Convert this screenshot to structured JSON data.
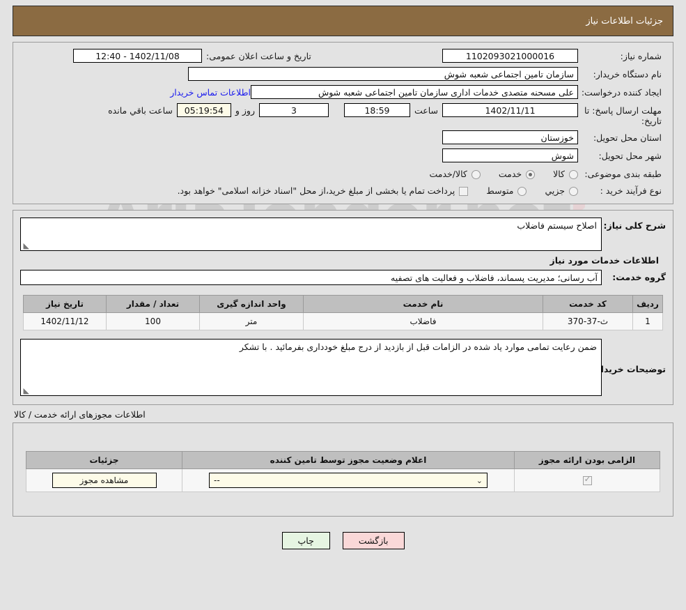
{
  "header": {
    "title": "جزئیات اطلاعات نیاز"
  },
  "watermark": {
    "text": "AriaTender.net"
  },
  "info": {
    "need_number_label": "شماره نیاز:",
    "need_number_value": "1102093021000016",
    "announce_label": "تاریخ و ساعت اعلان عمومی:",
    "announce_value": "1402/11/08 - 12:40",
    "buyer_org_label": "نام دستگاه خریدار:",
    "buyer_org_value": "سازمان تامین اجتماعی شعبه شوش",
    "creator_label": "ایجاد کننده درخواست:",
    "creator_value": "علی مسحنه متصدی خدمات اداری سازمان تامین اجتماعی شعبه شوش",
    "contact_link": "اطلاعات تماس خریدار",
    "deadline_label": "مهلت ارسال پاسخ: تا تاریخ:",
    "deadline_date": "1402/11/11",
    "time_label": "ساعت",
    "deadline_time": "18:59",
    "days_value": "3",
    "days_label": "روز و",
    "countdown_value": "05:19:54",
    "countdown_label": "ساعت باقي مانده",
    "province_label": "استان محل تحویل:",
    "province_value": "خوزستان",
    "city_label": "شهر محل تحویل:",
    "city_value": "شوش",
    "category_label": "طبقه بندی موضوعی:",
    "category_options": [
      {
        "label": "کالا",
        "selected": false
      },
      {
        "label": "خدمت",
        "selected": true
      },
      {
        "label": "کالا/خدمت",
        "selected": false
      }
    ],
    "process_label": "نوع فرآیند خرید :",
    "process_options": [
      {
        "label": "جزیي",
        "selected": false
      },
      {
        "label": "متوسط",
        "selected": false
      }
    ],
    "treasury_checked": false,
    "treasury_note": "پرداخت تمام یا بخشی از مبلغ خرید،از محل \"اسناد خزانه اسلامی\" خواهد بود."
  },
  "description": {
    "need_desc_label": "شرح کلی نیاز:",
    "need_desc_value": "اصلاح سیستم فاضلاب",
    "services_heading": "اطلاعات خدمات مورد نیاز",
    "service_group_label": "گروه خدمت:",
    "service_group_value": "آب رسانی؛ مدیریت پسماند، فاضلاب و فعالیت های تصفیه"
  },
  "items_table": {
    "columns": [
      "ردیف",
      "کد خدمت",
      "نام خدمت",
      "واحد اندازه گیری",
      "تعداد / مقدار",
      "تاریخ نیاز"
    ],
    "rows": [
      {
        "row": "1",
        "code": "ث-37-370",
        "name": "فاضلاب",
        "unit": "متر",
        "quantity": "100",
        "date": "1402/11/12"
      }
    ]
  },
  "buyer_notes": {
    "label": "توضیحات خریدار:",
    "value": "ضمن رعایت تمامی موارد یاد شده در الزامات قبل از بازدید از درج مبلغ خودداری بفرمائید . با تشکر"
  },
  "permits": {
    "caption": "اطلاعات مجوزهای ارائه خدمت / کالا",
    "columns": [
      "الزامی بودن ارائه مجوز",
      "اعلام وضعیت مجوز توسط تامین کننده",
      "جزئیات"
    ],
    "rows": [
      {
        "required_checked": true,
        "status_value": "--",
        "details_button": "مشاهده مجوز"
      }
    ]
  },
  "footer": {
    "back_label": "بازگشت",
    "print_label": "چاپ"
  },
  "colors": {
    "header_bg": "#8b6b42",
    "page_bg": "#e3e3e3",
    "link": "#1a1aee",
    "back_btn": "#fad8d8",
    "print_btn": "#e6f5e2",
    "cream_field": "#fdfbe8",
    "table_header": "#bfbfbf"
  }
}
